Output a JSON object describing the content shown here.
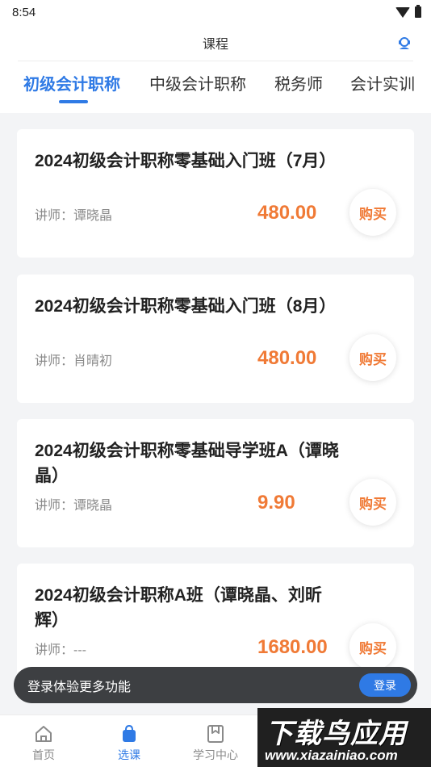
{
  "status_bar": {
    "time": "8:54"
  },
  "header": {
    "title": "课程"
  },
  "tabs": [
    {
      "label": "初级会计职称",
      "active": true
    },
    {
      "label": "中级会计职称",
      "active": false
    },
    {
      "label": "税务师",
      "active": false
    },
    {
      "label": "会计实训",
      "active": false
    }
  ],
  "courses": [
    {
      "title": "2024初级会计职称零基础入门班（7月）",
      "teacher": "讲师：谭晓晶",
      "price": "480.00",
      "buy_label": "购买"
    },
    {
      "title": "2024初级会计职称零基础入门班（8月）",
      "teacher": "讲师：肖晴初",
      "price": "480.00",
      "buy_label": "购买"
    },
    {
      "title": "2024初级会计职称零基础导学班A（谭晓晶）",
      "teacher": "讲师：谭晓晶",
      "price": "9.90",
      "buy_label": "购买"
    },
    {
      "title": "2024初级会计职称A班（谭晓晶、刘昕辉）",
      "teacher": "讲师：---",
      "price": "1680.00",
      "buy_label": "购买"
    }
  ],
  "toast": {
    "text": "登录体验更多功能",
    "button_label": "登录"
  },
  "bottom_nav": [
    {
      "label": "首页",
      "icon": "home-icon",
      "active": false
    },
    {
      "label": "选课",
      "icon": "bag-icon",
      "active": true
    },
    {
      "label": "学习中心",
      "icon": "bookmark-icon",
      "active": false
    }
  ],
  "watermark": {
    "main": "下载鸟应用",
    "sub": "www.xiazainiao.com"
  },
  "colors": {
    "accent": "#2f7ae5",
    "price": "#f07a36",
    "toast_bg": "#3d3f42"
  }
}
